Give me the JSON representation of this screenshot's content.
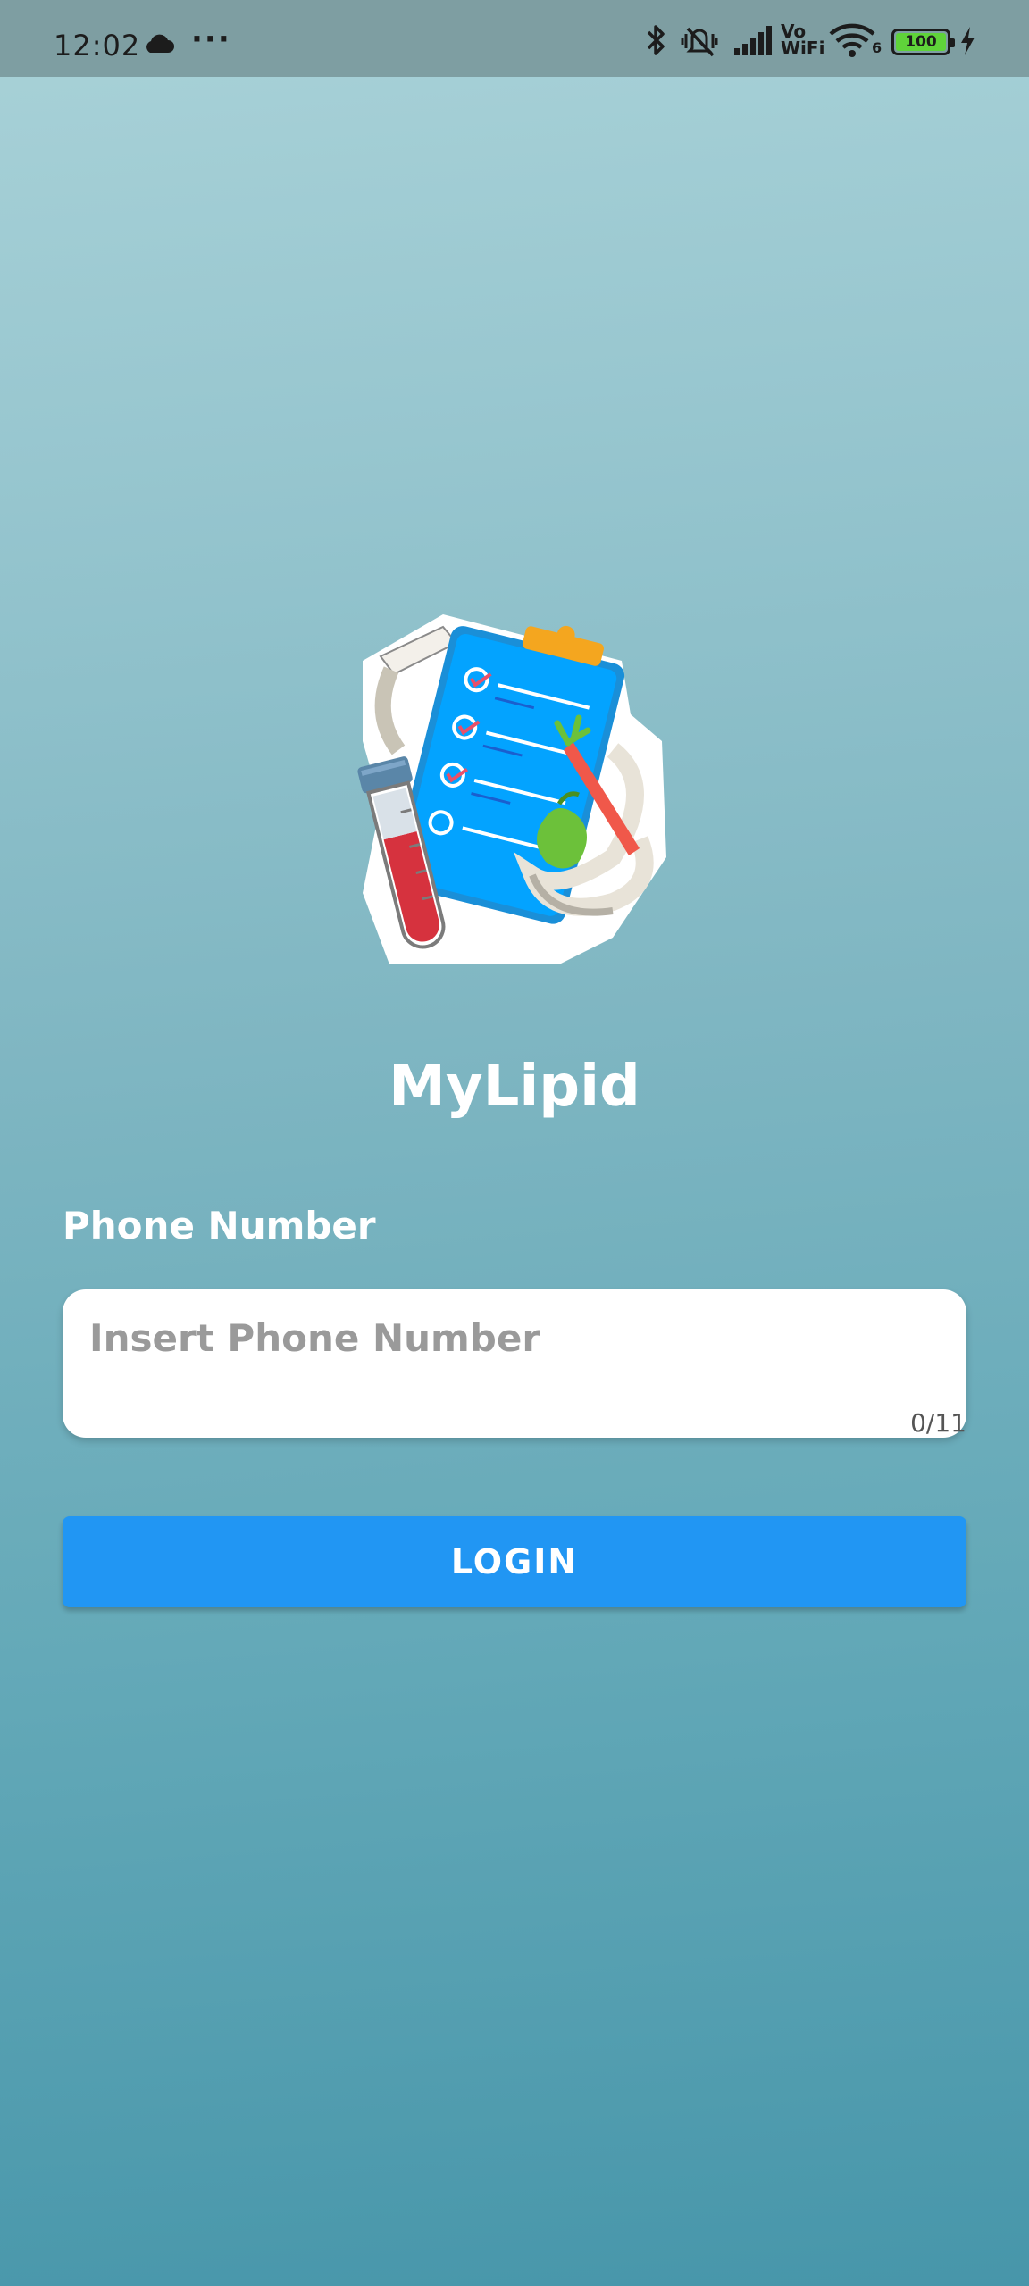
{
  "status_bar": {
    "time": "12:02",
    "left_icons": [
      "cloud-icon",
      "more-dots-icon"
    ],
    "right_icons": [
      "bluetooth-icon",
      "silent-vibrate-icon",
      "signal-icon",
      "vowifi-icon",
      "wifi-icon",
      "battery-icon",
      "charging-icon"
    ],
    "vowifi_top": "Vo",
    "vowifi_bottom": "WiFi",
    "wifi_badge": "6",
    "battery_level": "100",
    "battery_color": "#5fd33a"
  },
  "app": {
    "title": "MyLipid",
    "logo_icon": "clipboard-health-logo-icon"
  },
  "form": {
    "phone_label": "Phone Number",
    "phone_placeholder": "Insert Phone Number",
    "phone_value": "",
    "char_counter": "0/11",
    "login_label": "LOGIN"
  },
  "colors": {
    "primary_button": "#2196f3",
    "background_top": "#a9d2d8",
    "background_bottom": "#4796aa"
  }
}
